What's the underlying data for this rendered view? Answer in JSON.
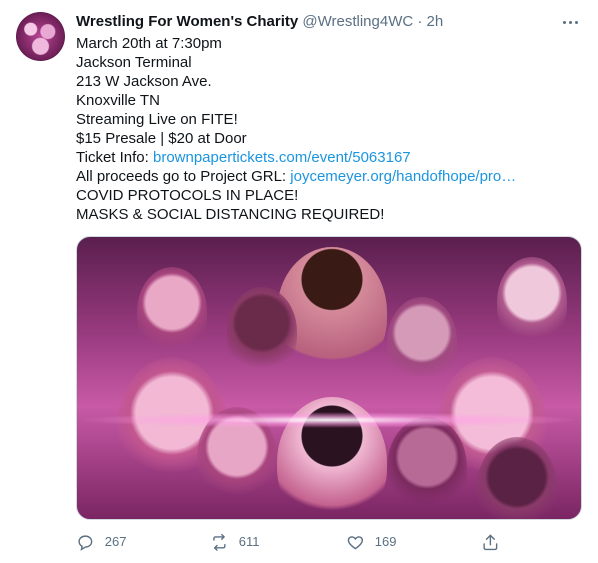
{
  "tweet": {
    "author": {
      "name": "Wrestling For Women's Charity",
      "handle": "@Wrestling4WC",
      "separator": "·",
      "time": "2h"
    },
    "lines": [
      "March 20th at 7:30pm",
      "Jackson Terminal",
      "213 W Jackson Ave.",
      "Knoxville TN",
      "Streaming Live on FITE!",
      "$15 Presale | $20 at Door"
    ],
    "ticket": {
      "prefix": "Ticket Info: ",
      "link": "brownpapertickets.com/event/5063167"
    },
    "proceeds": {
      "prefix": "All proceeds go to Project GRL: ",
      "link": "joycemeyer.org/handofhope/pro…"
    },
    "tail_lines": [
      "COVID PROTOCOLS IN PLACE!",
      "MASKS & SOCIAL DISTANCING REQUIRED!"
    ],
    "actions": {
      "replies": "267",
      "retweets": "611",
      "likes": "169"
    }
  },
  "colors": {
    "link": "#1b95e0",
    "secondary_text": "#5b7083",
    "primary_text": "#0f1419"
  },
  "icons": {
    "more": "more-horizontal-icon",
    "reply": "reply-icon",
    "retweet": "retweet-icon",
    "like": "heart-icon",
    "share": "share-icon"
  }
}
